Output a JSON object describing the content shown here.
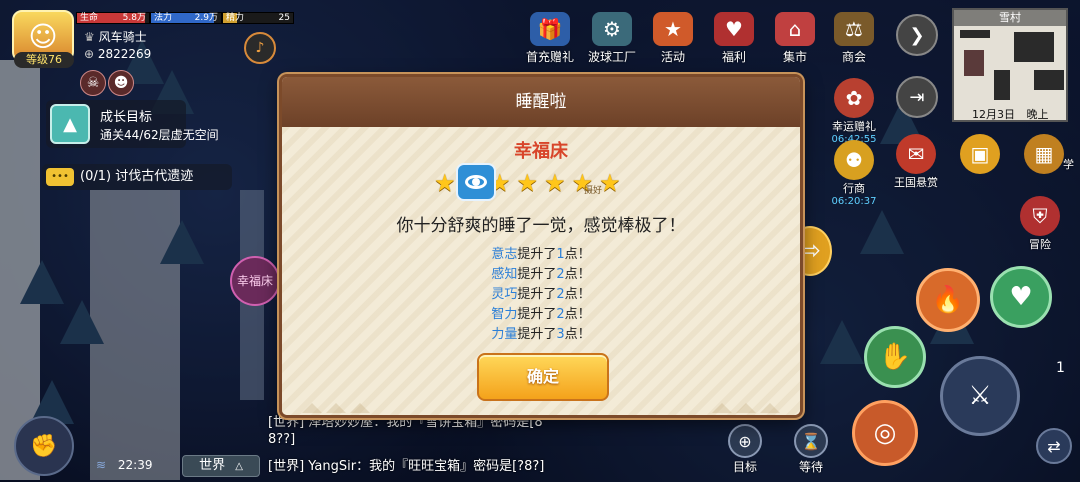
{
  "player": {
    "level": "等级76",
    "name": "风车骑士",
    "coins": "2822269",
    "stats": [
      {
        "label": "生命",
        "value": "5.8万",
        "color": "#e04040",
        "fill": 0.95
      },
      {
        "label": "法力",
        "value": "2.9万",
        "color": "#3b7de0",
        "fill": 0.9
      },
      {
        "label": "精力",
        "value": "25",
        "color": "#e0b030",
        "fill": 0.2
      }
    ]
  },
  "quests": {
    "growth_title": "成长目标",
    "growth_desc": "通关44/62层虚无空间",
    "ancient_count": "(0/1)",
    "ancient_desc": "讨伐古代遗迹"
  },
  "top_menu": [
    {
      "label": "首充赠礼",
      "icon": "gift-icon",
      "color": "#2d5ea8"
    },
    {
      "label": "波球工厂",
      "icon": "factory-icon",
      "color": "#3b6a7a"
    },
    {
      "label": "活动",
      "icon": "event-icon",
      "color": "#d05a2a"
    },
    {
      "label": "福利",
      "icon": "welfare-icon",
      "color": "#b03030"
    },
    {
      "label": "集市",
      "icon": "market-icon",
      "color": "#c04040"
    },
    {
      "label": "商会",
      "icon": "guild-icon",
      "color": "#7a5a2a"
    }
  ],
  "right_panel": [
    {
      "label": "幸运赠礼",
      "time": "06:42:55",
      "icon": "lucky-gift-icon"
    },
    {
      "label": "行商",
      "time": "06:20:37",
      "icon": "merchant-icon"
    },
    {
      "label": "王国悬赏",
      "time": "",
      "icon": "bounty-icon"
    },
    {
      "label": "冒险",
      "time": "",
      "icon": "adventure-icon"
    },
    {
      "label": "学",
      "time": "",
      "icon": "study-icon"
    }
  ],
  "minimap": {
    "title": "雪村",
    "date": "12月3日",
    "time_of_day": "晚上"
  },
  "dialog": {
    "title": "睡醒啦",
    "bed_name": "幸福床",
    "stars": 6,
    "star_note": "摄好",
    "message": "你十分舒爽的睡了一觉，感觉棒极了！",
    "attributes": [
      {
        "name": "意志",
        "verb": "提升了",
        "amount": "1",
        "unit": "点！"
      },
      {
        "name": "感知",
        "verb": "提升了",
        "amount": "2",
        "unit": "点！"
      },
      {
        "name": "灵巧",
        "verb": "提升了",
        "amount": "2",
        "unit": "点！"
      },
      {
        "name": "智力",
        "verb": "提升了",
        "amount": "2",
        "unit": "点！"
      },
      {
        "name": "力量",
        "verb": "提升了",
        "amount": "3",
        "unit": "点！"
      }
    ],
    "confirm": "确定"
  },
  "chat": {
    "lines": [
      "[世界] 泽塔妙妙屋：我的『雪饼宝箱』密码是[8",
      "8??]",
      "[世界] YangSir：我的『旺旺宝箱』密码是[?8?]"
    ],
    "channel": "世界",
    "clock": "22:39",
    "behind_dialog": "幸福床"
  },
  "bottom_actions": [
    {
      "label": "目标",
      "icon": "target-icon"
    },
    {
      "label": "等待",
      "icon": "hourglass-icon"
    }
  ],
  "action_number": "1"
}
